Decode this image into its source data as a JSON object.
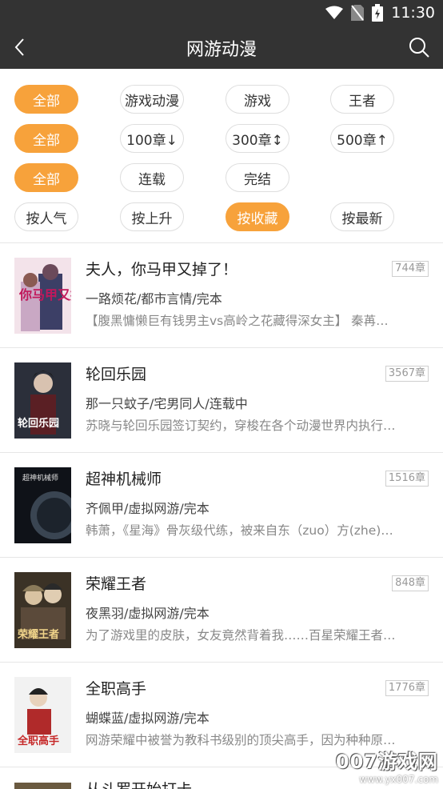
{
  "status_bar": {
    "time": "11:30"
  },
  "app_bar": {
    "title": "网游动漫"
  },
  "filters": {
    "row1": [
      "全部",
      "游戏动漫",
      "游戏",
      "王者"
    ],
    "row2": [
      "全部",
      "100章↓",
      "300章↕",
      "500章↑"
    ],
    "row3": [
      "全部",
      "连载",
      "完结"
    ],
    "row4": [
      "按人气",
      "按上升",
      "按收藏",
      "按最新"
    ],
    "selected": {
      "row1": "全部",
      "row2": "全部",
      "row3": "全部",
      "row4": "按收藏"
    },
    "accent_color": "#f7a23b"
  },
  "books": [
    {
      "title": "夫人，你马甲又掉了！",
      "meta": "一路烦花/都市言情/完本",
      "desc": "【腹黑慵懒巨有钱男主vs高岭之花藏得深女主】 秦苒…",
      "chapters": "744章",
      "cover_text": "你马甲又掉了"
    },
    {
      "title": "轮回乐园",
      "meta": "那一只蚊子/宅男同人/连载中",
      "desc": "苏晓与轮回乐园签订契约，穿梭在各个动漫世界内执行…",
      "chapters": "3567章",
      "cover_text": "轮回乐园"
    },
    {
      "title": "超神机械师",
      "meta": "齐佩甲/虚拟网游/完本",
      "desc": "韩萧，《星海》骨灰级代练，被来自东（zuo）方(zhe)…",
      "chapters": "1516章",
      "cover_text": "超神机械师"
    },
    {
      "title": "荣耀王者",
      "meta": "夜黑羽/虚拟网游/完本",
      "desc": "为了游戏里的皮肤，女友竟然背着我……百星荣耀王者…",
      "chapters": "848章",
      "cover_text": "荣耀王者"
    },
    {
      "title": "全职高手",
      "meta": "蝴蝶蓝/虚拟网游/完本",
      "desc": "网游荣耀中被誉为教科书级别的顶尖高手，因为种种原…",
      "chapters": "1776章",
      "cover_text": "全职高手"
    }
  ],
  "partial_book": {
    "title": "从斗罗开始打卡"
  },
  "watermark": {
    "brand": "007游戏网",
    "url": "www.yx007.com"
  }
}
